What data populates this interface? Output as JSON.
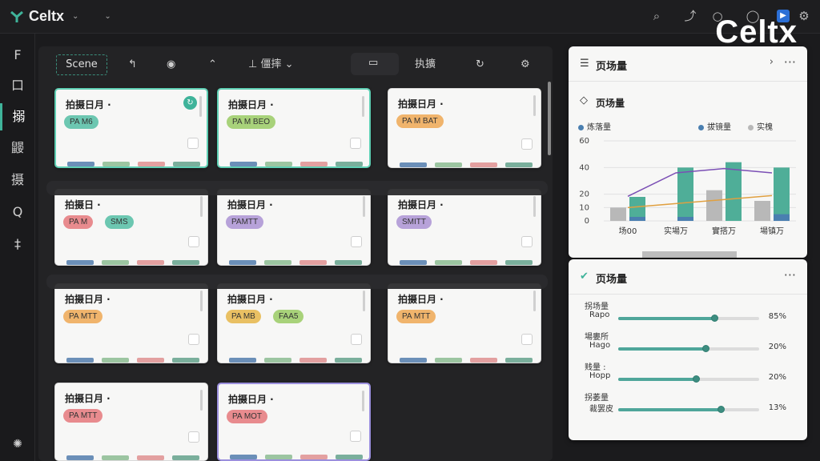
{
  "app": {
    "name": "Celtx",
    "brand_overlay": "Celtx"
  },
  "toolbar": {
    "scene": "Scene",
    "filter": "僵摔",
    "sort": "执擴"
  },
  "sidebar": {
    "items": [
      {
        "label": "F"
      },
      {
        "label": "口"
      },
      {
        "label": "搦"
      },
      {
        "label": "鼹"
      },
      {
        "label": "摄"
      },
      {
        "label": "Q"
      },
      {
        "label": "‡"
      }
    ]
  },
  "cards": [
    {
      "title": "拍摄日月 ·",
      "tags": [
        {
          "text": "PA M6",
          "color": "teal"
        }
      ]
    },
    {
      "title": "拍摄日月 ·",
      "tags": [
        {
          "text": "PA M BEO",
          "color": "green"
        }
      ]
    },
    {
      "title": "拍摄日月 ·",
      "tags": [
        {
          "text": "PA M BAT",
          "color": "orange"
        }
      ]
    },
    {
      "title": "拍摄日 ·",
      "tags": [
        {
          "text": "PA M",
          "color": "red"
        },
        {
          "text": "SMS",
          "color": "teal"
        }
      ]
    },
    {
      "title": "拍摄日月 ·",
      "tags": [
        {
          "text": "PAMTT",
          "color": "purple"
        }
      ]
    },
    {
      "title": "拍摄日月 ·",
      "tags": [
        {
          "text": "SMITT",
          "color": "purple"
        }
      ]
    },
    {
      "title": "拍摄日月 ·",
      "tags": [
        {
          "text": "PA MTT",
          "color": "orange"
        }
      ]
    },
    {
      "title": "拍摄日月 ·",
      "tags": [
        {
          "text": "PA MB",
          "color": "gold"
        },
        {
          "text": "FAA5",
          "color": "green"
        }
      ]
    },
    {
      "title": "拍摄日月 ·",
      "tags": [
        {
          "text": "PA MTT",
          "color": "orange"
        }
      ]
    },
    {
      "title": "拍摄日月 ·",
      "tags": [
        {
          "text": "PA MTT",
          "color": "red"
        }
      ]
    },
    {
      "title": "拍摄日月 ·",
      "tags": [
        {
          "text": "PA MOT",
          "color": "red"
        }
      ]
    }
  ],
  "panel1": {
    "header": "页场量",
    "sub": "页场量",
    "legend": [
      "炼落量",
      "拔镜量",
      "实槐"
    ]
  },
  "chart_data": {
    "type": "bar",
    "categories": [
      "场00",
      "实場万",
      "實搭万",
      "場镇万"
    ],
    "series": [
      {
        "name": "炼落量",
        "color": "#4a7fb0",
        "values": [
          3,
          3,
          0,
          5
        ]
      },
      {
        "name": "拔镜量",
        "color": "#b8b8b8",
        "values": [
          10,
          0,
          23,
          15
        ]
      },
      {
        "name": "实槐",
        "color": "#4fae98",
        "values": [
          18,
          40,
          44,
          40
        ]
      }
    ],
    "ylim": [
      0,
      60
    ],
    "yticks": [
      0,
      10,
      20,
      40,
      60
    ]
  },
  "panel2": {
    "header": "页场量",
    "rows": [
      {
        "cat": "拐场量",
        "label": "Rapo",
        "value": "85%",
        "fraction": 0.68
      },
      {
        "cat": "場婁所",
        "label": "Hago",
        "value": "20%",
        "fraction": 0.62
      },
      {
        "cat": "贱量 :",
        "label": "Hopp",
        "value": "20%",
        "fraction": 0.55
      },
      {
        "cat": "拐萎量",
        "label": "裁罢皮",
        "value": "13%",
        "fraction": 0.73
      }
    ]
  }
}
